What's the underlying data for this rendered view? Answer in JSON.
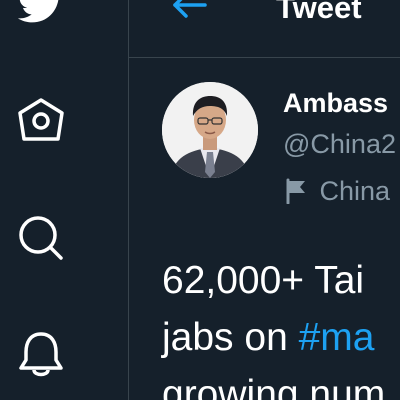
{
  "header": {
    "title": "Tweet"
  },
  "nav": {
    "items": [
      {
        "name": "twitter-logo",
        "icon": "bird-icon"
      },
      {
        "name": "home",
        "icon": "home-icon"
      },
      {
        "name": "explore",
        "icon": "search-icon"
      },
      {
        "name": "notifications",
        "icon": "bell-icon"
      }
    ]
  },
  "tweet": {
    "author": {
      "display_name": "Ambass",
      "handle": "@China2",
      "label": "China"
    },
    "lines": {
      "line1": "62,000+ Tai",
      "line2_prefix": "jabs on ",
      "line2_hashtag": "#ma",
      "line3": "growing num"
    }
  },
  "colors": {
    "background": "#15202b",
    "accent": "#1da1f2",
    "secondary_text": "#8899a6",
    "border": "#38444d",
    "primary_text": "#ffffff"
  }
}
